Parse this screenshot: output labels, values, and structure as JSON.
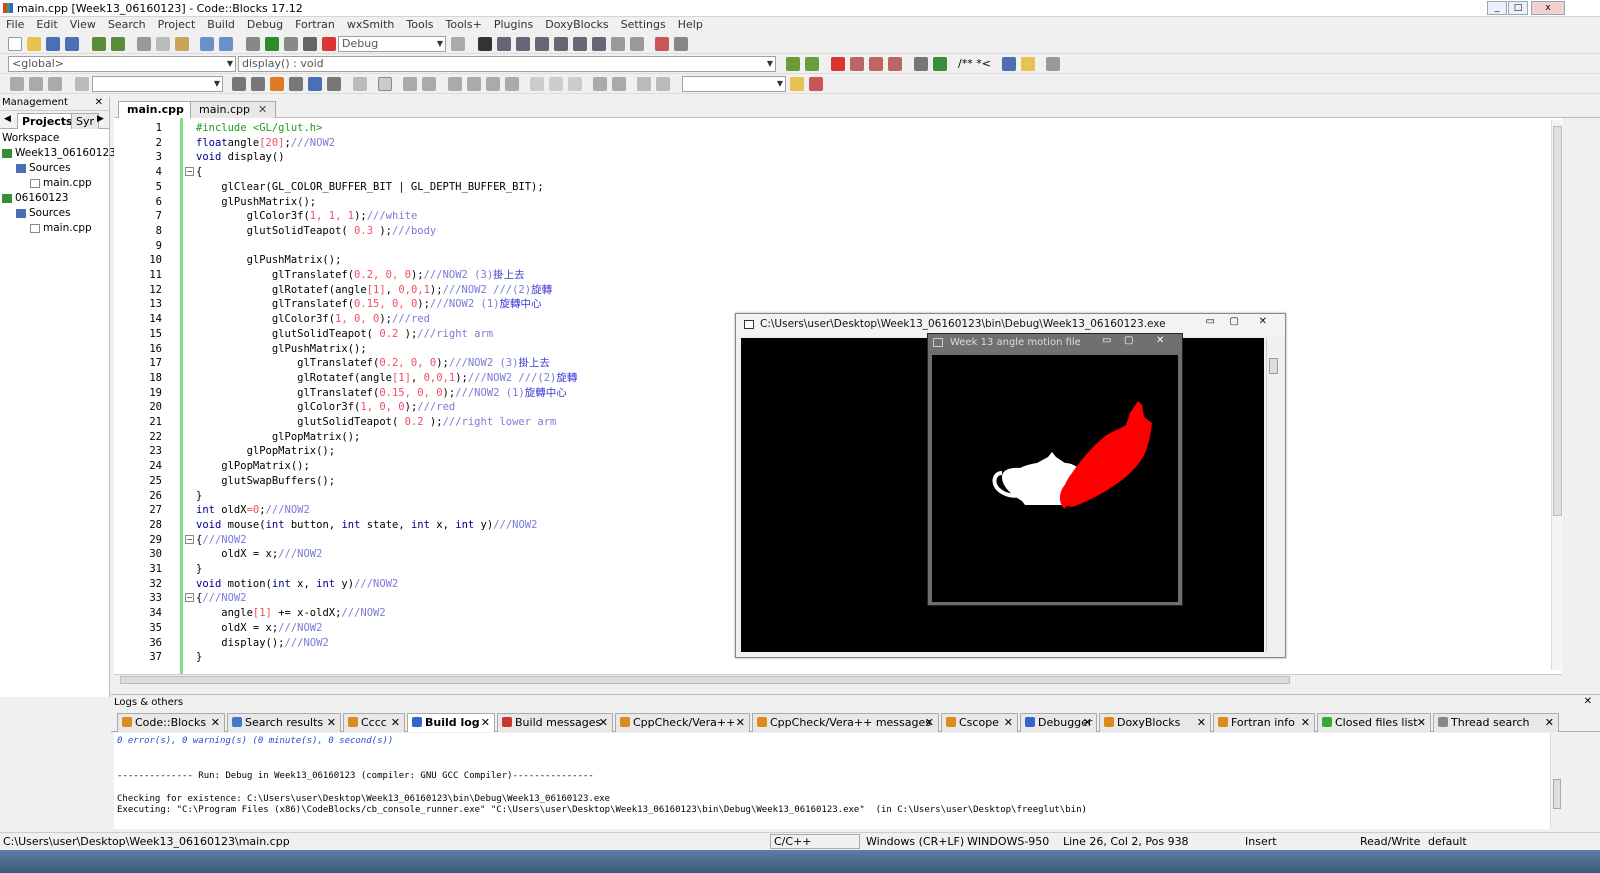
{
  "window": {
    "title": "main.cpp [Week13_06160123] - Code::Blocks 17.12"
  },
  "menu": [
    "File",
    "Edit",
    "View",
    "Search",
    "Project",
    "Build",
    "Debug",
    "Fortran",
    "wxSmith",
    "Tools",
    "Tools+",
    "Plugins",
    "DoxyBlocks",
    "Settings",
    "Help"
  ],
  "toolbar": {
    "build_target": "Debug",
    "scope": "<global>",
    "function": "display() : void",
    "comment_tools": "/** *<"
  },
  "management": {
    "title": "Management",
    "tabs": [
      "Projects",
      "Syr"
    ],
    "tree": [
      {
        "label": "Workspace",
        "indent": 0,
        "icon": "workspace"
      },
      {
        "label": "Week13_06160123",
        "indent": 0,
        "icon": "project-icon"
      },
      {
        "label": "Sources",
        "indent": 1,
        "icon": "folder-icon"
      },
      {
        "label": "main.cpp",
        "indent": 2,
        "icon": "file-icon"
      },
      {
        "label": "06160123",
        "indent": 0,
        "icon": "project-icon"
      },
      {
        "label": "Sources",
        "indent": 1,
        "icon": "folder-icon"
      },
      {
        "label": "main.cpp",
        "indent": 2,
        "icon": "file-icon"
      }
    ]
  },
  "editor_tabs": [
    {
      "label": "main.cpp",
      "active": true
    },
    {
      "label": "main.cpp",
      "active": false
    }
  ],
  "code": [
    [
      [
        "pp",
        "#include <GL/glut.h>"
      ]
    ],
    [
      [
        "kw",
        "float"
      ],
      [
        "",
        "angle"
      ],
      [
        "nm",
        "[20]"
      ],
      [
        "",
        ";"
      ],
      [
        "cm",
        "///NOW2"
      ]
    ],
    [
      [
        "kw",
        "void"
      ],
      [
        "",
        " display()"
      ]
    ],
    [
      [
        "",
        "{"
      ]
    ],
    [
      [
        "",
        "    glClear(GL_COLOR_BUFFER_BIT | GL_DEPTH_BUFFER_BIT);"
      ]
    ],
    [
      [
        "",
        "    glPushMatrix();"
      ]
    ],
    [
      [
        "",
        "        glColor3f("
      ],
      [
        "nm",
        "1, 1, 1"
      ],
      [
        "",
        ");"
      ],
      [
        "cm",
        "///white"
      ]
    ],
    [
      [
        "",
        "        glutSolidTeapot( "
      ],
      [
        "nm",
        "0.3"
      ],
      [
        "",
        " );"
      ],
      [
        "cm",
        "///body"
      ]
    ],
    [
      [
        "",
        ""
      ]
    ],
    [
      [
        "",
        "        glPushMatrix();"
      ]
    ],
    [
      [
        "",
        "            glTranslatef("
      ],
      [
        "nm",
        "0.2, 0, 0"
      ],
      [
        "",
        ");"
      ],
      [
        "cm",
        "///NOW2 (3)"
      ],
      [
        "cjk",
        "掛上去"
      ]
    ],
    [
      [
        "",
        "            glRotatef(angle"
      ],
      [
        "nm",
        "[1]"
      ],
      [
        "",
        ", "
      ],
      [
        "nm",
        "0,0,1"
      ],
      [
        "",
        ");"
      ],
      [
        "cm",
        "///NOW2 ///(2)"
      ],
      [
        "cjk",
        "旋轉"
      ]
    ],
    [
      [
        "",
        "            glTranslatef("
      ],
      [
        "nm",
        "0.15, 0, 0"
      ],
      [
        "",
        ");"
      ],
      [
        "cm",
        "///NOW2 (1)"
      ],
      [
        "cjk",
        "旋轉中心"
      ]
    ],
    [
      [
        "",
        "            glColor3f("
      ],
      [
        "nm",
        "1, 0, 0"
      ],
      [
        "",
        ");"
      ],
      [
        "cm",
        "///red"
      ]
    ],
    [
      [
        "",
        "            glutSolidTeapot( "
      ],
      [
        "nm",
        "0.2"
      ],
      [
        "",
        " );"
      ],
      [
        "cm",
        "///right arm"
      ]
    ],
    [
      [
        "",
        "            glPushMatrix();"
      ]
    ],
    [
      [
        "",
        "                glTranslatef("
      ],
      [
        "nm",
        "0.2, 0, 0"
      ],
      [
        "",
        ");"
      ],
      [
        "cm",
        "///NOW2 (3)"
      ],
      [
        "cjk",
        "掛上去"
      ]
    ],
    [
      [
        "",
        "                glRotatef(angle"
      ],
      [
        "nm",
        "[1]"
      ],
      [
        "",
        ", "
      ],
      [
        "nm",
        "0,0,1"
      ],
      [
        "",
        ");"
      ],
      [
        "cm",
        "///NOW2 ///(2)"
      ],
      [
        "cjk",
        "旋轉"
      ]
    ],
    [
      [
        "",
        "                glTranslatef("
      ],
      [
        "nm",
        "0.15, 0, 0"
      ],
      [
        "",
        ");"
      ],
      [
        "cm",
        "///NOW2 (1)"
      ],
      [
        "cjk",
        "旋轉中心"
      ]
    ],
    [
      [
        "",
        "                glColor3f("
      ],
      [
        "nm",
        "1, 0, 0"
      ],
      [
        "",
        ");"
      ],
      [
        "cm",
        "///red"
      ]
    ],
    [
      [
        "",
        "                glutSolidTeapot( "
      ],
      [
        "nm",
        "0.2"
      ],
      [
        "",
        " );"
      ],
      [
        "cm",
        "///right lower arm"
      ]
    ],
    [
      [
        "",
        "            glPopMatrix();"
      ]
    ],
    [
      [
        "",
        "        glPopMatrix();"
      ]
    ],
    [
      [
        "",
        "    glPopMatrix();"
      ]
    ],
    [
      [
        "",
        "    glutSwapBuffers();"
      ]
    ],
    [
      [
        "",
        "}"
      ]
    ],
    [
      [
        "kw",
        "int"
      ],
      [
        "",
        " oldX"
      ],
      [
        "nm",
        "=0"
      ],
      [
        "",
        ";"
      ],
      [
        "cm",
        "///NOW2"
      ]
    ],
    [
      [
        "kw",
        "void"
      ],
      [
        "",
        " mouse("
      ],
      [
        "kw",
        "int"
      ],
      [
        "",
        " button, "
      ],
      [
        "kw",
        "int"
      ],
      [
        "",
        " state, "
      ],
      [
        "kw",
        "int"
      ],
      [
        "",
        " x, "
      ],
      [
        "kw",
        "int"
      ],
      [
        "",
        " y)"
      ],
      [
        "cm",
        "///NOW2"
      ]
    ],
    [
      [
        "",
        "{"
      ],
      [
        "cm",
        "///NOW2"
      ]
    ],
    [
      [
        "",
        "    oldX = x;"
      ],
      [
        "cm",
        "///NOW2"
      ]
    ],
    [
      [
        "",
        "}"
      ]
    ],
    [
      [
        "kw",
        "void"
      ],
      [
        "",
        " motion("
      ],
      [
        "kw",
        "int"
      ],
      [
        "",
        " x, "
      ],
      [
        "kw",
        "int"
      ],
      [
        "",
        " y)"
      ],
      [
        "cm",
        "///NOW2"
      ]
    ],
    [
      [
        "",
        "{"
      ],
      [
        "cm",
        "///NOW2"
      ]
    ],
    [
      [
        "",
        "    angle"
      ],
      [
        "nm",
        "[1]"
      ],
      [
        "",
        " += x-oldX;"
      ],
      [
        "cm",
        "///NOW2"
      ]
    ],
    [
      [
        "",
        "    oldX = x;"
      ],
      [
        "cm",
        "///NOW2"
      ]
    ],
    [
      [
        "",
        "    display();"
      ],
      [
        "cm",
        "///NOW2"
      ]
    ],
    [
      [
        "",
        "}"
      ]
    ]
  ],
  "console_window": {
    "title": "C:\\Users\\user\\Desktop\\Week13_06160123\\bin\\Debug\\Week13_06160123.exe"
  },
  "glut_window": {
    "title": "Week 13 angle motion file"
  },
  "logs": {
    "title": "Logs & others",
    "tabs": [
      {
        "label": "Code::Blocks",
        "color": "#d98c1a"
      },
      {
        "label": "Search results",
        "color": "#4477cc"
      },
      {
        "label": "Cccc",
        "color": "#d98c1a"
      },
      {
        "label": "Build log",
        "color": "#3366cc",
        "active": true
      },
      {
        "label": "Build messages",
        "color": "#cc3333"
      },
      {
        "label": "CppCheck/Vera++",
        "color": "#d98c1a"
      },
      {
        "label": "CppCheck/Vera++ messages",
        "color": "#d98c1a"
      },
      {
        "label": "Cscope",
        "color": "#d98c1a"
      },
      {
        "label": "Debugger",
        "color": "#3366cc"
      },
      {
        "label": "DoxyBlocks",
        "color": "#d98c1a"
      },
      {
        "label": "Fortran info",
        "color": "#d98c1a"
      },
      {
        "label": "Closed files list",
        "color": "#33aa33"
      },
      {
        "label": "Thread search",
        "color": "#888888"
      }
    ],
    "lines": [
      "0 error(s), 0 warning(s) (0 minute(s), 0 second(s))",
      "",
      "",
      "-------------- Run: Debug in Week13_06160123 (compiler: GNU GCC Compiler)---------------",
      "",
      "Checking for existence: C:\\Users\\user\\Desktop\\Week13_06160123\\bin\\Debug\\Week13_06160123.exe",
      "Executing: \"C:\\Program Files (x86)\\CodeBlocks/cb_console_runner.exe\" \"C:\\Users\\user\\Desktop\\Week13_06160123\\bin\\Debug\\Week13_06160123.exe\"  (in C:\\Users\\user\\Desktop\\freeglut\\bin)"
    ]
  },
  "status": {
    "path": "C:\\Users\\user\\Desktop\\Week13_06160123\\main.cpp",
    "language": "C/C++",
    "line_endings": "Windows (CR+LF)",
    "encoding": "WINDOWS-950",
    "position": "Line 26, Col 2, Pos 938",
    "mode": "Insert",
    "access": "Read/Write",
    "profile": "default"
  },
  "colors": {
    "accent_green": "#7fe07f",
    "teapot_red": "#ff0000",
    "teapot_white": "#ffffff"
  }
}
